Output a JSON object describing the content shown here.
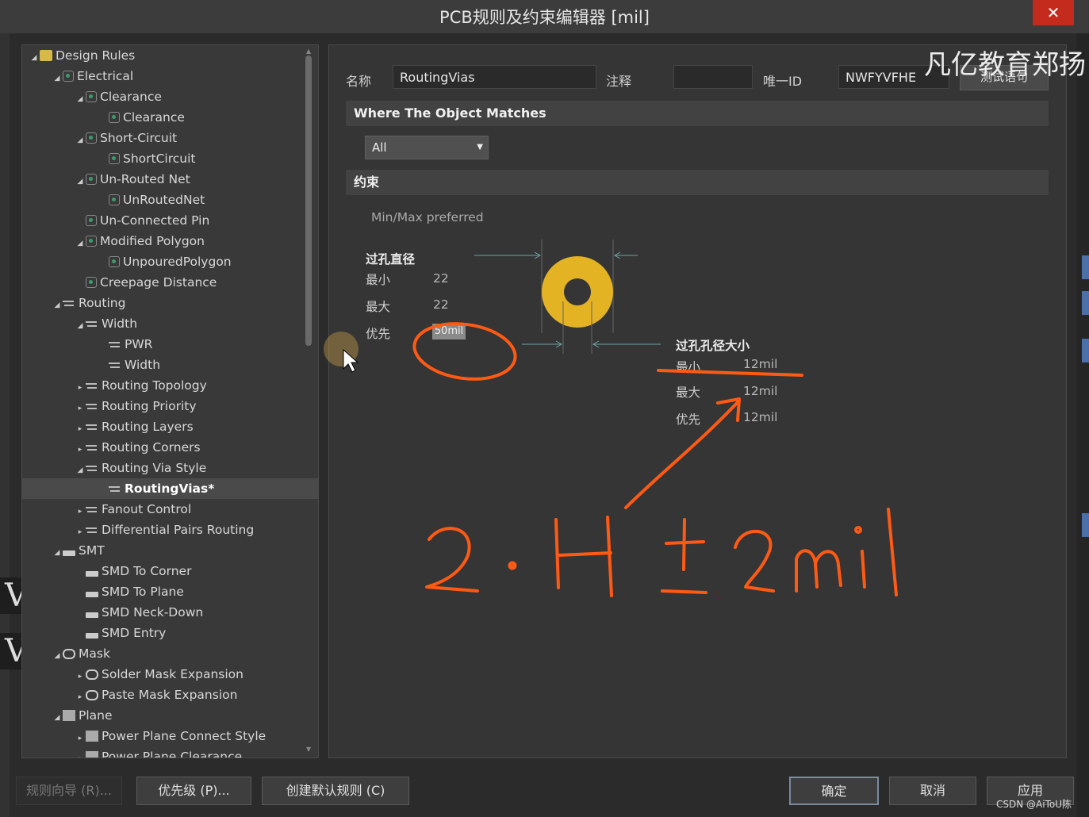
{
  "window": {
    "title": "PCB规则及约束编辑器 [mil]",
    "close_label": "✕"
  },
  "watermark": "凡亿教育郑扬",
  "credit": "CSDN @AiToU陈",
  "side_letter": "V",
  "tree": {
    "items": [
      {
        "label": "Design Rules",
        "level": 0,
        "arrow": "◢",
        "icon": "folder-icon"
      },
      {
        "label": "Electrical",
        "level": 1,
        "arrow": "◢",
        "icon": "rule-icon"
      },
      {
        "label": "Clearance",
        "level": 2,
        "arrow": "◢",
        "icon": "rule-icon"
      },
      {
        "label": "Clearance",
        "level": 3,
        "arrow": "",
        "icon": "rule-icon"
      },
      {
        "label": "Short-Circuit",
        "level": 2,
        "arrow": "◢",
        "icon": "rule-icon"
      },
      {
        "label": "ShortCircuit",
        "level": 3,
        "arrow": "",
        "icon": "rule-icon"
      },
      {
        "label": "Un-Routed Net",
        "level": 2,
        "arrow": "◢",
        "icon": "rule-icon"
      },
      {
        "label": "UnRoutedNet",
        "level": 3,
        "arrow": "",
        "icon": "rule-icon"
      },
      {
        "label": "Un-Connected Pin",
        "level": 2,
        "arrow": "",
        "icon": "rule-icon"
      },
      {
        "label": "Modified Polygon",
        "level": 2,
        "arrow": "◢",
        "icon": "rule-icon"
      },
      {
        "label": "UnpouredPolygon",
        "level": 3,
        "arrow": "",
        "icon": "rule-icon"
      },
      {
        "label": "Creepage Distance",
        "level": 2,
        "arrow": "",
        "icon": "rule-icon"
      },
      {
        "label": "Routing",
        "level": 1,
        "arrow": "◢",
        "icon": "routing-icon"
      },
      {
        "label": "Width",
        "level": 2,
        "arrow": "◢",
        "icon": "routing-icon"
      },
      {
        "label": "PWR",
        "level": 3,
        "arrow": "",
        "icon": "routing-icon"
      },
      {
        "label": "Width",
        "level": 3,
        "arrow": "",
        "icon": "routing-icon"
      },
      {
        "label": "Routing Topology",
        "level": 2,
        "arrow": "▸",
        "icon": "routing-icon"
      },
      {
        "label": "Routing Priority",
        "level": 2,
        "arrow": "▸",
        "icon": "routing-icon"
      },
      {
        "label": "Routing Layers",
        "level": 2,
        "arrow": "▸",
        "icon": "routing-icon"
      },
      {
        "label": "Routing Corners",
        "level": 2,
        "arrow": "▸",
        "icon": "routing-icon"
      },
      {
        "label": "Routing Via Style",
        "level": 2,
        "arrow": "◢",
        "icon": "routing-icon"
      },
      {
        "label": "RoutingVias*",
        "level": 3,
        "arrow": "",
        "icon": "routing-icon",
        "selected": true
      },
      {
        "label": "Fanout Control",
        "level": 2,
        "arrow": "▸",
        "icon": "routing-icon"
      },
      {
        "label": "Differential Pairs Routing",
        "level": 2,
        "arrow": "▸",
        "icon": "routing-icon"
      },
      {
        "label": "SMT",
        "level": 1,
        "arrow": "◢",
        "icon": "smt-icon"
      },
      {
        "label": "SMD To Corner",
        "level": 2,
        "arrow": "",
        "icon": "smt-icon"
      },
      {
        "label": "SMD To Plane",
        "level": 2,
        "arrow": "",
        "icon": "smt-icon"
      },
      {
        "label": "SMD Neck-Down",
        "level": 2,
        "arrow": "",
        "icon": "smt-icon"
      },
      {
        "label": "SMD Entry",
        "level": 2,
        "arrow": "",
        "icon": "smt-icon"
      },
      {
        "label": "Mask",
        "level": 1,
        "arrow": "◢",
        "icon": "mask-icon"
      },
      {
        "label": "Solder Mask Expansion",
        "level": 2,
        "arrow": "▸",
        "icon": "mask-icon"
      },
      {
        "label": "Paste Mask Expansion",
        "level": 2,
        "arrow": "▸",
        "icon": "mask-icon"
      },
      {
        "label": "Plane",
        "level": 1,
        "arrow": "◢",
        "icon": "plane-icon"
      },
      {
        "label": "Power Plane Connect Style",
        "level": 2,
        "arrow": "▸",
        "icon": "plane-icon"
      },
      {
        "label": "Power Plane Clearance",
        "level": 2,
        "arrow": "▸",
        "icon": "plane-icon"
      }
    ]
  },
  "header": {
    "name_label": "名称",
    "name_value": "RoutingVias",
    "comment_label": "注释",
    "comment_value": "",
    "uid_label": "唯一ID",
    "uid_value": "NWFYVFHE",
    "test_button": "测试语句"
  },
  "where": {
    "section_title": "Where The Object Matches",
    "dropdown_value": "All"
  },
  "constraints": {
    "section_title": "约束",
    "mode_label": "Min/Max preferred",
    "via_diameter": {
      "title": "过孔直径",
      "min_label": "最小",
      "min_value": "22",
      "max_label": "最大",
      "max_value": "22",
      "pref_label": "优先",
      "pref_value": "50mil"
    },
    "hole_size": {
      "title": "过孔孔径大小",
      "min_label": "最小",
      "min_value": "12mil",
      "max_label": "最大",
      "max_value": "12mil",
      "pref_label": "优先",
      "pref_value": "12mil"
    },
    "via_color": "#e3b324"
  },
  "annotation": {
    "handwriting": "2·H±2mil",
    "color": "#ff5a14"
  },
  "footer": {
    "wizard": "规则向导 (R)...",
    "priority": "优先级 (P)...",
    "create_default": "创建默认规则 (C)",
    "ok": "确定",
    "cancel": "取消",
    "apply": "应用"
  }
}
